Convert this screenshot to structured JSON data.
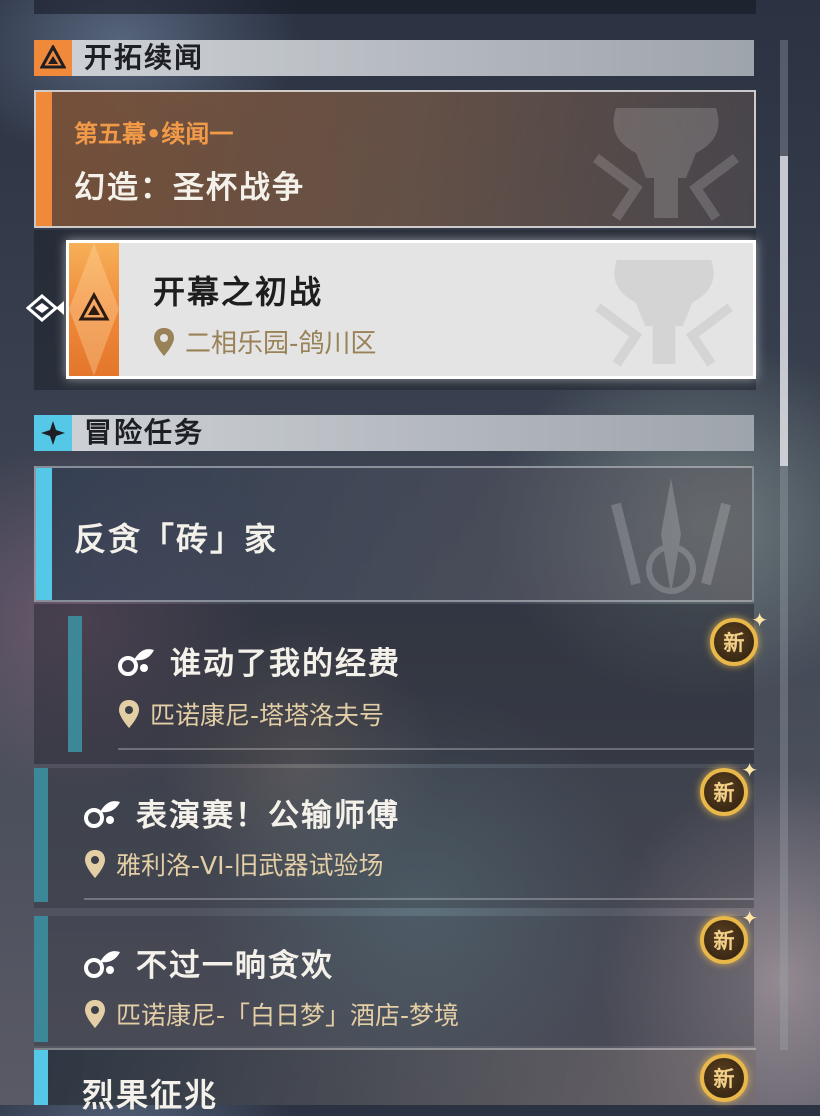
{
  "sections": {
    "trailblaze": {
      "title": "开拓续闻",
      "icon": "trailblaze-triangle-icon",
      "color": "#f08a3a"
    },
    "adventure": {
      "title": "冒险任务",
      "icon": "adventure-star-icon",
      "color": "#55c8e8"
    }
  },
  "trailblaze_card": {
    "chapter": "第五幕•续闻一",
    "name": "幻造：圣杯战争",
    "emblem": "grail-emblem-icon"
  },
  "selected_quest": {
    "name": "开幕之初战",
    "location": "二相乐园-鸽川区",
    "icon": "trailblaze-triangle-icon",
    "pointer": "selection-pointer-icon"
  },
  "adventure_card": {
    "name": "反贪「砖」家",
    "emblem": "sword-emblem-icon"
  },
  "quests": [
    {
      "name": "谁动了我的经费",
      "location": "匹诺康尼-塔塔洛夫号",
      "badge": "新"
    },
    {
      "name": "表演赛！公输师傅",
      "location": "雅利洛-VI-旧武器试验场",
      "badge": "新"
    },
    {
      "name": "不过一晌贪欢",
      "location": "匹诺康尼-「白日梦」酒店-梦境",
      "badge": "新"
    }
  ],
  "bottom_card": {
    "name": "烈果征兆",
    "badge": "新"
  },
  "colors": {
    "trailblaze_accent": "#f08a3a",
    "adventure_accent": "#55c8e8",
    "location_gold": "#e3cea6"
  }
}
